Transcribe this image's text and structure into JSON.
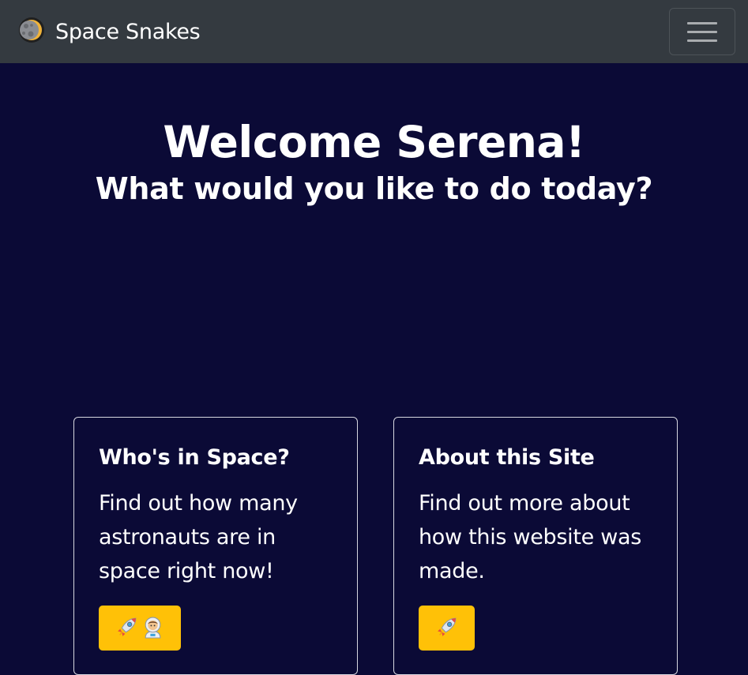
{
  "navbar": {
    "brand_name": "Space Snakes",
    "brand_icon": "moon-icon",
    "toggle_icon": "hamburger-menu-icon"
  },
  "hero": {
    "welcome": "Welcome Serena!",
    "question": "What would you like to do today?"
  },
  "cards": [
    {
      "title": "Who's in Space?",
      "text": "Find out how many astronauts are in space right now!",
      "button_icons": [
        "rocket-icon",
        "astronaut-icon"
      ]
    },
    {
      "title": "About this Site",
      "text": "Find out more about how this website was made.",
      "button_icons": [
        "rocket-icon"
      ]
    }
  ],
  "colors": {
    "navbar_bg": "#343a40",
    "page_bg": "#0b0a36",
    "button_bg": "#ffc107"
  }
}
